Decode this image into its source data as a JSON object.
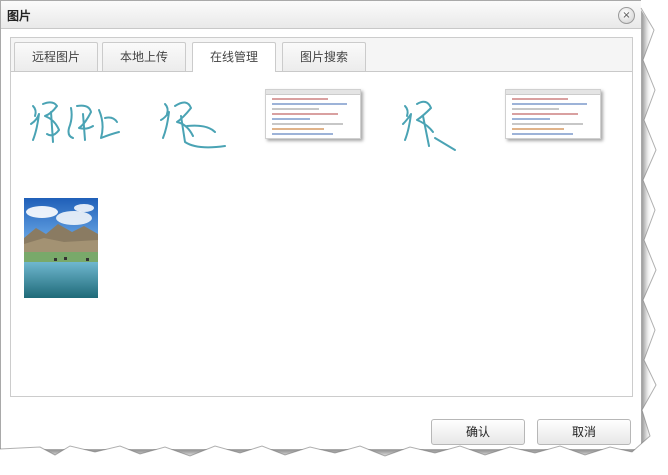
{
  "dialog": {
    "title": "图片",
    "close_glyph": "×"
  },
  "tabs": [
    {
      "label": "远程图片",
      "active": false
    },
    {
      "label": "本地上传",
      "active": false
    },
    {
      "label": "在线管理",
      "active": true
    },
    {
      "label": "图片搜索",
      "active": false
    }
  ],
  "images": [
    {
      "name": "handwriting-1",
      "kind": "handwriting"
    },
    {
      "name": "handwriting-2",
      "kind": "handwriting"
    },
    {
      "name": "code-screenshot-1",
      "kind": "screenshot"
    },
    {
      "name": "handwriting-3",
      "kind": "handwriting"
    },
    {
      "name": "code-screenshot-2",
      "kind": "screenshot"
    },
    {
      "name": "landscape-photo",
      "kind": "photo"
    }
  ],
  "buttons": {
    "ok": "确认",
    "cancel": "取消"
  },
  "colors": {
    "ink": "#4aa3b4",
    "title_bar": "#ededed"
  }
}
